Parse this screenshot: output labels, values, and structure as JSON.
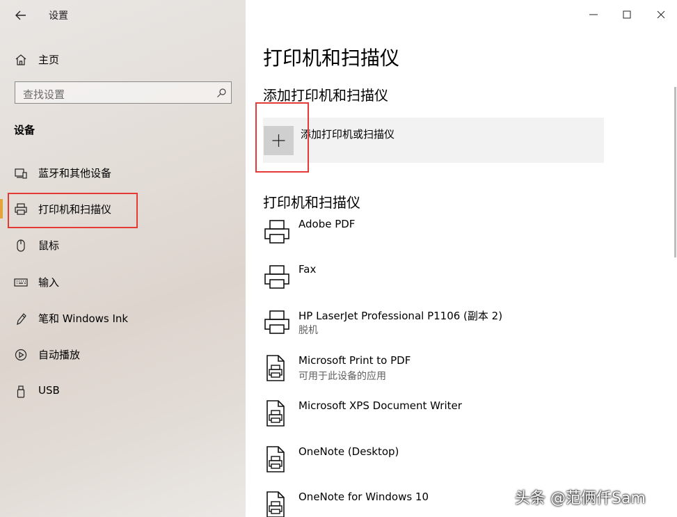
{
  "sidebar": {
    "title": "设置",
    "home": "主页",
    "search_placeholder": "查找设置",
    "section_title": "设备",
    "items": [
      {
        "label": "蓝牙和其他设备",
        "icon": "bluetooth-devices-icon"
      },
      {
        "label": "打印机和扫描仪",
        "icon": "printer-icon",
        "selected": true
      },
      {
        "label": "鼠标",
        "icon": "mouse-icon"
      },
      {
        "label": "输入",
        "icon": "keyboard-icon"
      },
      {
        "label": "笔和 Windows Ink",
        "icon": "pen-icon"
      },
      {
        "label": "自动播放",
        "icon": "autoplay-icon"
      },
      {
        "label": "USB",
        "icon": "usb-icon"
      }
    ]
  },
  "main": {
    "title": "打印机和扫描仪",
    "add_section_title": "添加打印机和扫描仪",
    "add_button_label": "添加打印机或扫描仪",
    "list_title": "打印机和扫描仪",
    "devices": [
      {
        "name": "Adobe PDF",
        "status": "",
        "icon": "printer-icon"
      },
      {
        "name": "Fax",
        "status": "",
        "icon": "printer-icon"
      },
      {
        "name": "HP LaserJet Professional P1106 (副本 2)",
        "status": "脱机",
        "icon": "printer-icon"
      },
      {
        "name": "Microsoft Print to PDF",
        "status": "可用于此设备的应用",
        "icon": "document-printer-icon"
      },
      {
        "name": "Microsoft XPS Document Writer",
        "status": "",
        "icon": "document-printer-icon"
      },
      {
        "name": "OneNote (Desktop)",
        "status": "",
        "icon": "document-printer-icon"
      },
      {
        "name": "OneNote for Windows 10",
        "status": "",
        "icon": "document-printer-icon"
      }
    ]
  },
  "watermark": "头条 @范俩仟Sam",
  "colors": {
    "accent": "#e5a33b",
    "highlight_box": "#e53935"
  }
}
